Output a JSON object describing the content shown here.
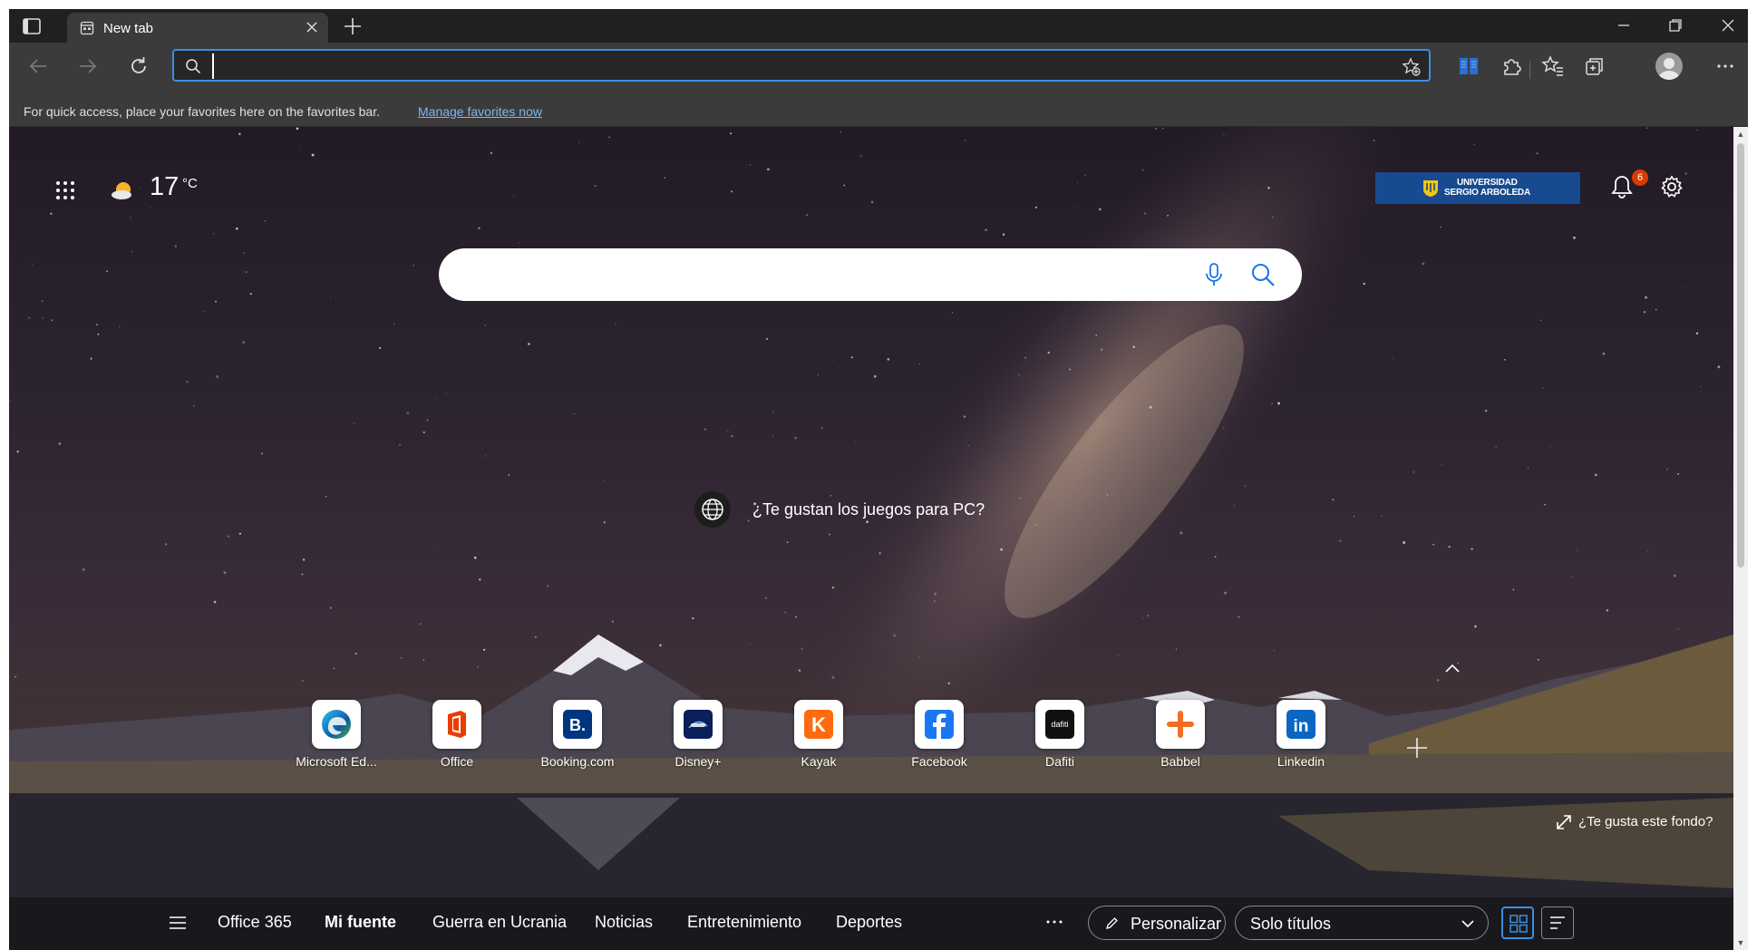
{
  "browser": {
    "tab": {
      "title": "New tab",
      "favicon": "new-tab-page-icon"
    },
    "address_bar": {
      "value": "",
      "placeholder": ""
    },
    "favorites_bar": {
      "message": "For quick access, place your favorites here on the favorites bar.",
      "link": "Manage favorites now"
    },
    "accent_color": "#3d8fe3"
  },
  "newtab": {
    "weather": {
      "temp": "17",
      "unit": "°C",
      "icon": "partly-sunny-icon"
    },
    "org_logo": {
      "line1": "UNIVERSIDAD",
      "line2": "SERGIO ARBOLEDA"
    },
    "notifications": {
      "count": "6"
    },
    "search": {
      "placeholder": ""
    },
    "promo": {
      "text": "¿Te gustan los juegos para PC?"
    },
    "quick_links": [
      {
        "label": "Microsoft Ed...",
        "icon": "edge-icon"
      },
      {
        "label": "Office",
        "icon": "office-icon"
      },
      {
        "label": "Booking.com",
        "icon": "booking-icon"
      },
      {
        "label": "Disney+",
        "icon": "disney-plus-icon"
      },
      {
        "label": "Kayak",
        "icon": "kayak-icon"
      },
      {
        "label": "Facebook",
        "icon": "facebook-icon"
      },
      {
        "label": "Dafiti",
        "icon": "dafiti-icon",
        "icon_text": "dafiti"
      },
      {
        "label": "Babbel",
        "icon": "babbel-icon"
      },
      {
        "label": "Linkedin",
        "icon": "linkedin-icon",
        "icon_text": "in"
      }
    ],
    "background_like": "¿Te gusta este fondo?",
    "feed": {
      "items": [
        "Office 365",
        "Mi fuente",
        "Guerra en Ucrania",
        "Noticias",
        "Entretenimiento",
        "Deportes"
      ],
      "active": "Mi fuente",
      "personalize": "Personalizar",
      "view_option": "Solo títulos"
    }
  }
}
